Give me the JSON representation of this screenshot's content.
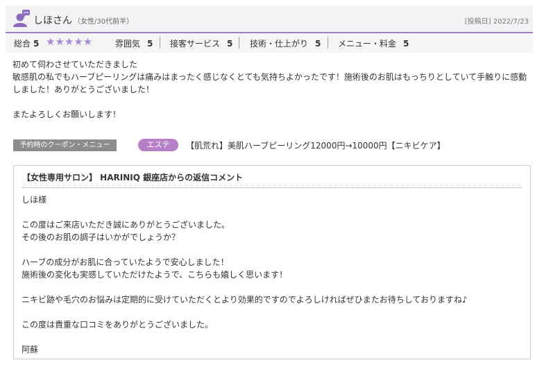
{
  "reviewer": {
    "name": "しほさん",
    "meta": "（女性/30代前半）",
    "post_date": "[投稿日] 2022/7/23"
  },
  "ratings": {
    "overall_label": "総合",
    "overall_value": "5",
    "stars": 5,
    "stars_glyphs": "★★★★★",
    "items": [
      {
        "label": "雰囲気",
        "value": "5"
      },
      {
        "label": "接客サービス",
        "value": "5"
      },
      {
        "label": "技術・仕上がり",
        "value": "5"
      },
      {
        "label": "メニュー・料金",
        "value": "5"
      }
    ]
  },
  "review_body": "初めて伺わさせていただきました\n敏感肌の私でもハーブピーリングは痛みはまったく感じなくとても気持ちよかったです！施術後のお肌はもっちりとしていて手触りに感動しました！ありがとうございました！\n\nまたよろしくお願いします！",
  "coupon": {
    "label": "予約時のクーポン・メニュー",
    "category": "エステ",
    "name": "【肌荒れ】美肌ハーブピーリング12000円→10000円【ニキビケア】"
  },
  "reply": {
    "title": "【女性専用サロン】 HARINIQ 銀座店からの返信コメント",
    "body": "しほ様\n\nこの度はご来店いただき誠にありがとうございました。\nその後のお肌の調子はいかがでしょうか？\n\nハーブの成分がお肌に合っていたようで安心しました！\n施術後の変化も実感していただけたようで、こちらも嬉しく思います！\n\nニキビ跡や毛穴のお悩みは定期的に受けていただくとより効果的ですのでよろしければぜひまたお待ちしておりますね♪\n\nこの度は貴重な口コミをありがとうございました。\n\n阿蘇"
  },
  "colors": {
    "accent": "#9b7cc4",
    "star": "#a98bd3",
    "badge": "#b67fc6",
    "coupon_label_bg": "#8c8c8c"
  }
}
